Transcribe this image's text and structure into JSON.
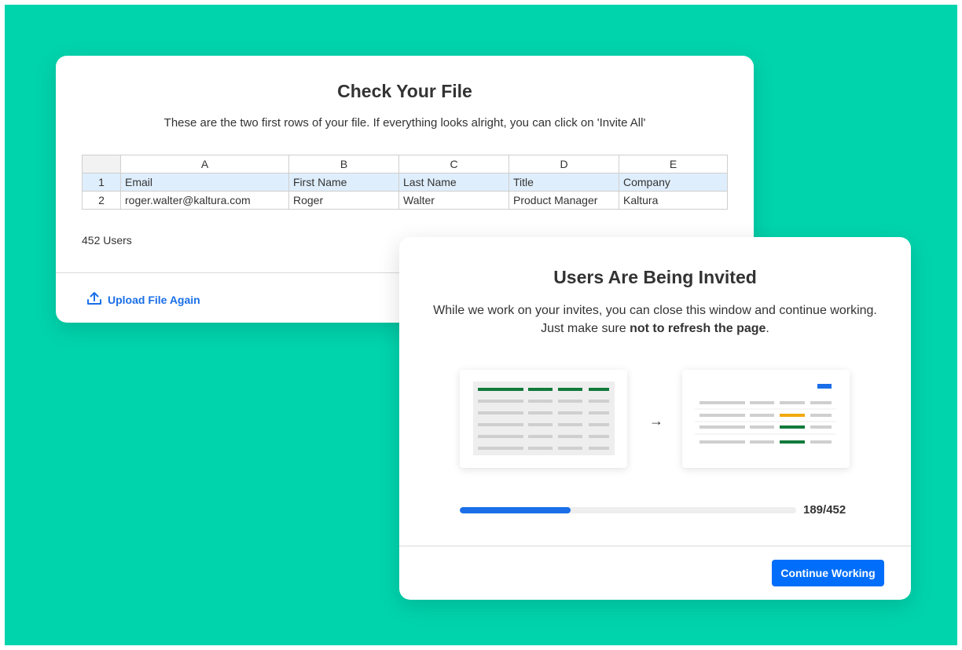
{
  "colors": {
    "background": "#00d4ad",
    "accent_blue": "#1a6fe8",
    "button_blue": "#006efa",
    "highlight_row": "#dfeefc",
    "green": "#117a3b",
    "amber": "#f2a90f"
  },
  "file_check": {
    "title": "Check Your File",
    "subtitle": "These are the two first rows of your file. If everything looks alright, you can click on 'Invite All'",
    "columns": [
      "A",
      "B",
      "C",
      "D",
      "E"
    ],
    "rows": [
      {
        "num": "1",
        "cells": [
          "Email",
          "First Name",
          "Last Name",
          "Title",
          "Company"
        ]
      },
      {
        "num": "2",
        "cells": [
          "roger.walter@kaltura.com",
          "Roger",
          "Walter",
          "Product Manager",
          "Kaltura"
        ]
      }
    ],
    "users_count": "452 Users",
    "upload_label": "Upload File Again",
    "upload_icon": "upload-icon"
  },
  "invite": {
    "title": "Users Are Being Invited",
    "message_prefix": "While we work on your invites, you can close this window and continue working. Just make sure ",
    "message_bold": "not to refresh the page",
    "message_suffix": ".",
    "arrow": "→",
    "progress_fraction": 0.33,
    "progress_text": "189/452",
    "continue_label": "Continue Working"
  }
}
